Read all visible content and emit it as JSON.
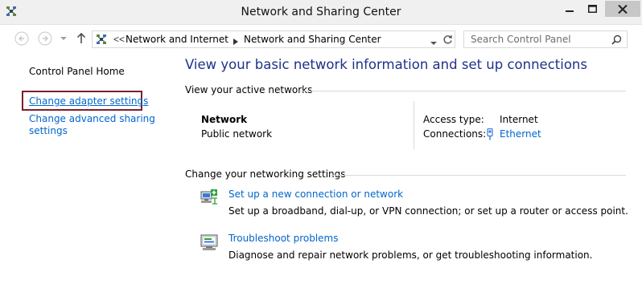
{
  "window": {
    "title": "Network and Sharing Center"
  },
  "address_bar": {
    "overflow_chevron": "<<",
    "breadcrumbs": [
      "Network and Internet",
      "Network and Sharing Center"
    ],
    "separator": "▶"
  },
  "search": {
    "placeholder": "Search Control Panel"
  },
  "left_pane": {
    "links": [
      {
        "label": "Control Panel Home"
      },
      {
        "label": "Change adapter settings",
        "highlighted": true
      },
      {
        "label": "Change advanced sharing settings"
      }
    ]
  },
  "main": {
    "heading": "View your basic network information and set up connections",
    "active_networks": {
      "section_title": "View your active networks",
      "network_name": "Network",
      "network_category": "Public network",
      "access_type_label": "Access type:",
      "access_type_value": "Internet",
      "connections_label": "Connections:",
      "connections_value": "Ethernet"
    },
    "change_settings": {
      "section_title": "Change your networking settings",
      "tasks": [
        {
          "link": "Set up a new connection or network",
          "description": "Set up a broadband, dial-up, or VPN connection; or set up a router or access point.",
          "icon": "new-connection-icon"
        },
        {
          "link": "Troubleshoot problems",
          "description": "Diagnose and repair network problems, or get troubleshooting information.",
          "icon": "troubleshoot-icon"
        }
      ]
    }
  },
  "colors": {
    "link": "#0066cc",
    "heading": "#1e3287",
    "highlight_border": "#7b1f2c",
    "close_button": "#c7c7c7"
  }
}
